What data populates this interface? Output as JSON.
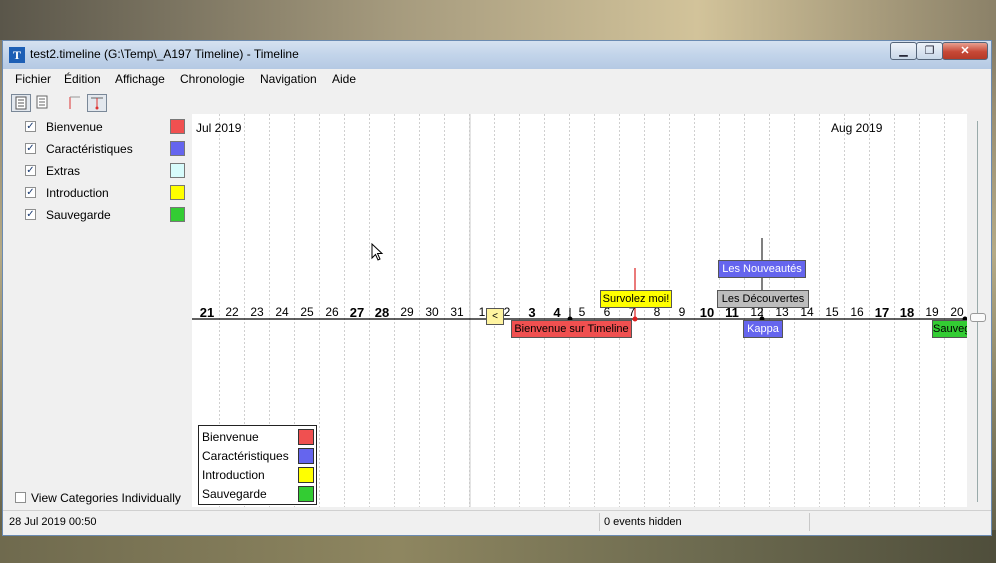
{
  "window": {
    "title": "test2.timeline (G:\\Temp\\_A197 Timeline) - Timeline",
    "icon": "timeline-app-icon",
    "controls": {
      "minimize": "▁",
      "maximize": "❐",
      "close": "✕"
    }
  },
  "menu": [
    "Fichier",
    "Édition",
    "Affichage",
    "Chronologie",
    "Navigation",
    "Aide"
  ],
  "toolbar": {
    "buttons": [
      "view-list-icon",
      "view-list-alt-icon",
      "flag-icon",
      "event-marker-icon"
    ]
  },
  "sidebar": {
    "categories": [
      {
        "label": "Bienvenue",
        "checked": true,
        "color": "#f05050"
      },
      {
        "label": "Caractéristiques",
        "checked": true,
        "color": "#6565ee"
      },
      {
        "label": "Extras",
        "checked": true,
        "color": "#d7fbfb"
      },
      {
        "label": "Introduction",
        "checked": true,
        "color": "#ffff00"
      },
      {
        "label": "Sauvegarde",
        "checked": true,
        "color": "#33cc33"
      }
    ],
    "view_individually": {
      "label": "View Categories Individually",
      "checked": false
    }
  },
  "timeline": {
    "months": [
      "Jul 2019",
      "Aug 2019"
    ],
    "days": [
      {
        "label": "21",
        "bold": true
      },
      {
        "label": "22",
        "bold": false
      },
      {
        "label": "23",
        "bold": false
      },
      {
        "label": "24",
        "bold": false
      },
      {
        "label": "25",
        "bold": false
      },
      {
        "label": "26",
        "bold": false
      },
      {
        "label": "27",
        "bold": true
      },
      {
        "label": "28",
        "bold": true
      },
      {
        "label": "29",
        "bold": false
      },
      {
        "label": "30",
        "bold": false
      },
      {
        "label": "31",
        "bold": false
      },
      {
        "label": "1",
        "bold": false
      },
      {
        "label": "2",
        "bold": false
      },
      {
        "label": "3",
        "bold": true
      },
      {
        "label": "4",
        "bold": true
      },
      {
        "label": "5",
        "bold": false
      },
      {
        "label": "6",
        "bold": false
      },
      {
        "label": "7",
        "bold": false
      },
      {
        "label": "8",
        "bold": false
      },
      {
        "label": "9",
        "bold": false
      },
      {
        "label": "10",
        "bold": true
      },
      {
        "label": "11",
        "bold": true
      },
      {
        "label": "12",
        "bold": false
      },
      {
        "label": "13",
        "bold": false
      },
      {
        "label": "14",
        "bold": false
      },
      {
        "label": "15",
        "bold": false
      },
      {
        "label": "16",
        "bold": false
      },
      {
        "label": "17",
        "bold": true
      },
      {
        "label": "18",
        "bold": true
      },
      {
        "label": "19",
        "bold": false
      },
      {
        "label": "20",
        "bold": false
      }
    ],
    "nav_back": "<",
    "events": [
      {
        "label": "Les Nouveautés",
        "color": "#6565ee",
        "text_color": "#ffffff"
      },
      {
        "label": "Survolez moi!",
        "color": "#ffff00",
        "text_color": "#000000"
      },
      {
        "label": "Les Découvertes",
        "color": "#bdbdbd",
        "text_color": "#000000"
      },
      {
        "label": "Bienvenue sur Timeline",
        "color": "#f05050",
        "text_color": "#000000"
      },
      {
        "label": "Kappa",
        "color": "#6565ee",
        "text_color": "#ffffff"
      },
      {
        "label": "Sauvegarde",
        "color": "#33cc33",
        "text_color": "#000000"
      }
    ]
  },
  "legend": [
    {
      "label": "Bienvenue",
      "color": "#f05050"
    },
    {
      "label": "Caractéristiques",
      "color": "#6565ee"
    },
    {
      "label": "Introduction",
      "color": "#ffff00"
    },
    {
      "label": "Sauvegarde",
      "color": "#33cc33"
    }
  ],
  "status": {
    "datetime": "28 Jul 2019 00:50",
    "hidden_events": "0 events hidden"
  }
}
